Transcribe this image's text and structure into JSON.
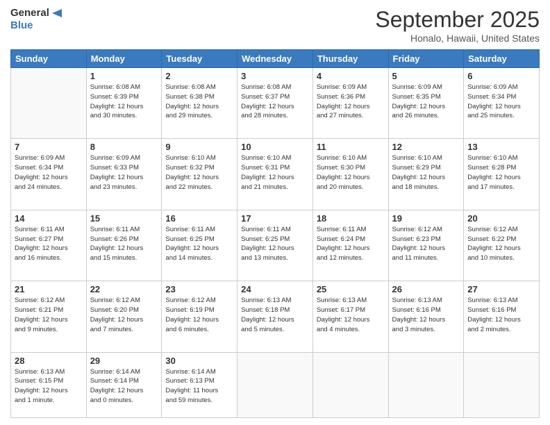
{
  "header": {
    "logo_line1": "General",
    "logo_line2": "Blue",
    "month_title": "September 2025",
    "location": "Honalo, Hawaii, United States"
  },
  "days_of_week": [
    "Sunday",
    "Monday",
    "Tuesday",
    "Wednesday",
    "Thursday",
    "Friday",
    "Saturday"
  ],
  "weeks": [
    [
      {
        "num": "",
        "info": ""
      },
      {
        "num": "1",
        "info": "Sunrise: 6:08 AM\nSunset: 6:39 PM\nDaylight: 12 hours\nand 30 minutes."
      },
      {
        "num": "2",
        "info": "Sunrise: 6:08 AM\nSunset: 6:38 PM\nDaylight: 12 hours\nand 29 minutes."
      },
      {
        "num": "3",
        "info": "Sunrise: 6:08 AM\nSunset: 6:37 PM\nDaylight: 12 hours\nand 28 minutes."
      },
      {
        "num": "4",
        "info": "Sunrise: 6:09 AM\nSunset: 6:36 PM\nDaylight: 12 hours\nand 27 minutes."
      },
      {
        "num": "5",
        "info": "Sunrise: 6:09 AM\nSunset: 6:35 PM\nDaylight: 12 hours\nand 26 minutes."
      },
      {
        "num": "6",
        "info": "Sunrise: 6:09 AM\nSunset: 6:34 PM\nDaylight: 12 hours\nand 25 minutes."
      }
    ],
    [
      {
        "num": "7",
        "info": "Sunrise: 6:09 AM\nSunset: 6:34 PM\nDaylight: 12 hours\nand 24 minutes."
      },
      {
        "num": "8",
        "info": "Sunrise: 6:09 AM\nSunset: 6:33 PM\nDaylight: 12 hours\nand 23 minutes."
      },
      {
        "num": "9",
        "info": "Sunrise: 6:10 AM\nSunset: 6:32 PM\nDaylight: 12 hours\nand 22 minutes."
      },
      {
        "num": "10",
        "info": "Sunrise: 6:10 AM\nSunset: 6:31 PM\nDaylight: 12 hours\nand 21 minutes."
      },
      {
        "num": "11",
        "info": "Sunrise: 6:10 AM\nSunset: 6:30 PM\nDaylight: 12 hours\nand 20 minutes."
      },
      {
        "num": "12",
        "info": "Sunrise: 6:10 AM\nSunset: 6:29 PM\nDaylight: 12 hours\nand 18 minutes."
      },
      {
        "num": "13",
        "info": "Sunrise: 6:10 AM\nSunset: 6:28 PM\nDaylight: 12 hours\nand 17 minutes."
      }
    ],
    [
      {
        "num": "14",
        "info": "Sunrise: 6:11 AM\nSunset: 6:27 PM\nDaylight: 12 hours\nand 16 minutes."
      },
      {
        "num": "15",
        "info": "Sunrise: 6:11 AM\nSunset: 6:26 PM\nDaylight: 12 hours\nand 15 minutes."
      },
      {
        "num": "16",
        "info": "Sunrise: 6:11 AM\nSunset: 6:25 PM\nDaylight: 12 hours\nand 14 minutes."
      },
      {
        "num": "17",
        "info": "Sunrise: 6:11 AM\nSunset: 6:25 PM\nDaylight: 12 hours\nand 13 minutes."
      },
      {
        "num": "18",
        "info": "Sunrise: 6:11 AM\nSunset: 6:24 PM\nDaylight: 12 hours\nand 12 minutes."
      },
      {
        "num": "19",
        "info": "Sunrise: 6:12 AM\nSunset: 6:23 PM\nDaylight: 12 hours\nand 11 minutes."
      },
      {
        "num": "20",
        "info": "Sunrise: 6:12 AM\nSunset: 6:22 PM\nDaylight: 12 hours\nand 10 minutes."
      }
    ],
    [
      {
        "num": "21",
        "info": "Sunrise: 6:12 AM\nSunset: 6:21 PM\nDaylight: 12 hours\nand 9 minutes."
      },
      {
        "num": "22",
        "info": "Sunrise: 6:12 AM\nSunset: 6:20 PM\nDaylight: 12 hours\nand 7 minutes."
      },
      {
        "num": "23",
        "info": "Sunrise: 6:12 AM\nSunset: 6:19 PM\nDaylight: 12 hours\nand 6 minutes."
      },
      {
        "num": "24",
        "info": "Sunrise: 6:13 AM\nSunset: 6:18 PM\nDaylight: 12 hours\nand 5 minutes."
      },
      {
        "num": "25",
        "info": "Sunrise: 6:13 AM\nSunset: 6:17 PM\nDaylight: 12 hours\nand 4 minutes."
      },
      {
        "num": "26",
        "info": "Sunrise: 6:13 AM\nSunset: 6:16 PM\nDaylight: 12 hours\nand 3 minutes."
      },
      {
        "num": "27",
        "info": "Sunrise: 6:13 AM\nSunset: 6:16 PM\nDaylight: 12 hours\nand 2 minutes."
      }
    ],
    [
      {
        "num": "28",
        "info": "Sunrise: 6:13 AM\nSunset: 6:15 PM\nDaylight: 12 hours\nand 1 minute."
      },
      {
        "num": "29",
        "info": "Sunrise: 6:14 AM\nSunset: 6:14 PM\nDaylight: 12 hours\nand 0 minutes."
      },
      {
        "num": "30",
        "info": "Sunrise: 6:14 AM\nSunset: 6:13 PM\nDaylight: 11 hours\nand 59 minutes."
      },
      {
        "num": "",
        "info": ""
      },
      {
        "num": "",
        "info": ""
      },
      {
        "num": "",
        "info": ""
      },
      {
        "num": "",
        "info": ""
      }
    ]
  ]
}
